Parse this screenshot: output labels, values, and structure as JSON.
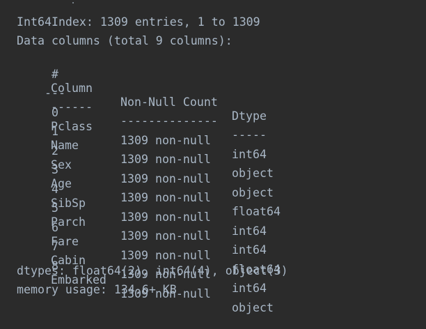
{
  "output": {
    "index_line": "Int64Index: 1309 entries, 1 to 1309",
    "columns_line": "Data columns (total 9 columns):",
    "header": {
      "num": " #",
      "column": "Column",
      "nonnull": "Non-Null Count",
      "dtype": "Dtype"
    },
    "separator": {
      "num": "---",
      "column": "------",
      "nonnull": "--------------",
      "dtype": "-----"
    },
    "rows": [
      {
        "num": " 0",
        "column": "Pclass",
        "nonnull": "1309 non-null",
        "dtype": "int64"
      },
      {
        "num": " 1",
        "column": "Name",
        "nonnull": "1309 non-null",
        "dtype": "object"
      },
      {
        "num": " 2",
        "column": "Sex",
        "nonnull": "1309 non-null",
        "dtype": "object"
      },
      {
        "num": " 3",
        "column": "Age",
        "nonnull": "1309 non-null",
        "dtype": "float64"
      },
      {
        "num": " 4",
        "column": "SibSp",
        "nonnull": "1309 non-null",
        "dtype": "int64"
      },
      {
        "num": " 5",
        "column": "Parch",
        "nonnull": "1309 non-null",
        "dtype": "int64"
      },
      {
        "num": " 6",
        "column": "Fare",
        "nonnull": "1309 non-null",
        "dtype": "float64"
      },
      {
        "num": " 7",
        "column": "Cabin",
        "nonnull": "1309 non-null",
        "dtype": "int64"
      },
      {
        "num": " 8",
        "column": "Embarked",
        "nonnull": "1309 non-null",
        "dtype": "object"
      }
    ],
    "dtypes_line": "dtypes: float64(2), int64(4), object(3)",
    "memory_line": "memory usage: 134.6+ KB"
  },
  "colors": {
    "background": "#2b2b2b",
    "text": "#a9b7c6"
  }
}
